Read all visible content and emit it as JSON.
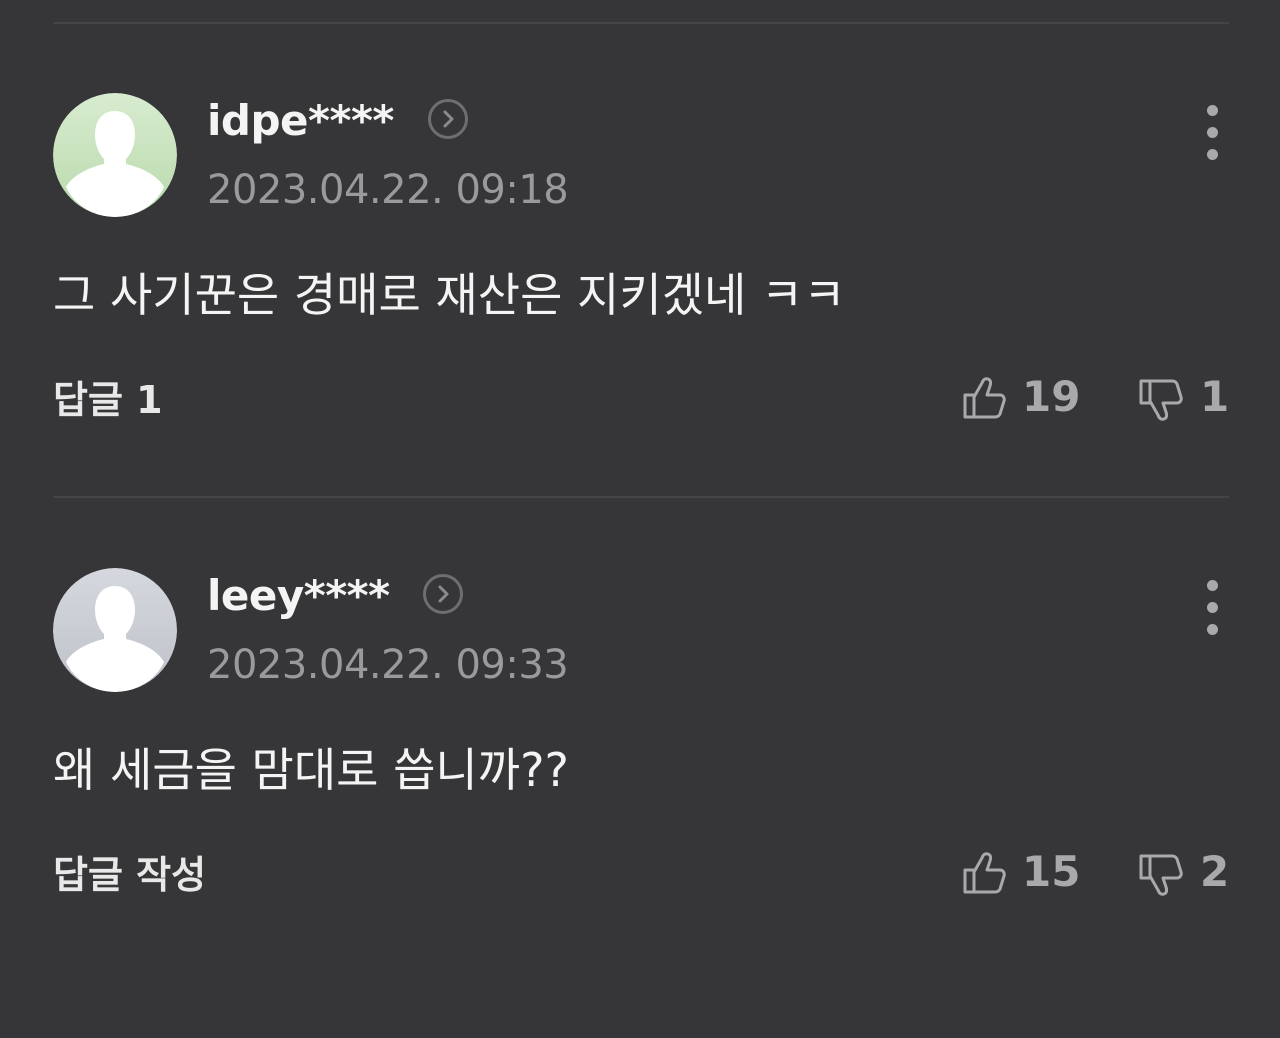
{
  "comments": [
    {
      "username": "idpe****",
      "timestamp": "2023.04.22. 09:18",
      "body": "그 사기꾼은 경매로 재산은 지키겠네 ㅋㅋ",
      "reply_label": "답글 1",
      "likes": "19",
      "dislikes": "1",
      "avatar_icon": "user-silhouette-icon",
      "avatar_color": "#c9e3bf"
    },
    {
      "username": "leey****",
      "timestamp": "2023.04.22. 09:33",
      "body": "왜 세금을 맘대로 씁니까??",
      "reply_label": "답글 작성",
      "likes": "15",
      "dislikes": "2",
      "avatar_icon": "user-silhouette-icon",
      "avatar_color": "#c9cbd3"
    }
  ],
  "theme": {
    "background": "#363638",
    "divider": "#454548",
    "primary_text": "#f4f4f4",
    "secondary_text": "#9a9a9d",
    "icon_gray": "#a9a9ad"
  }
}
